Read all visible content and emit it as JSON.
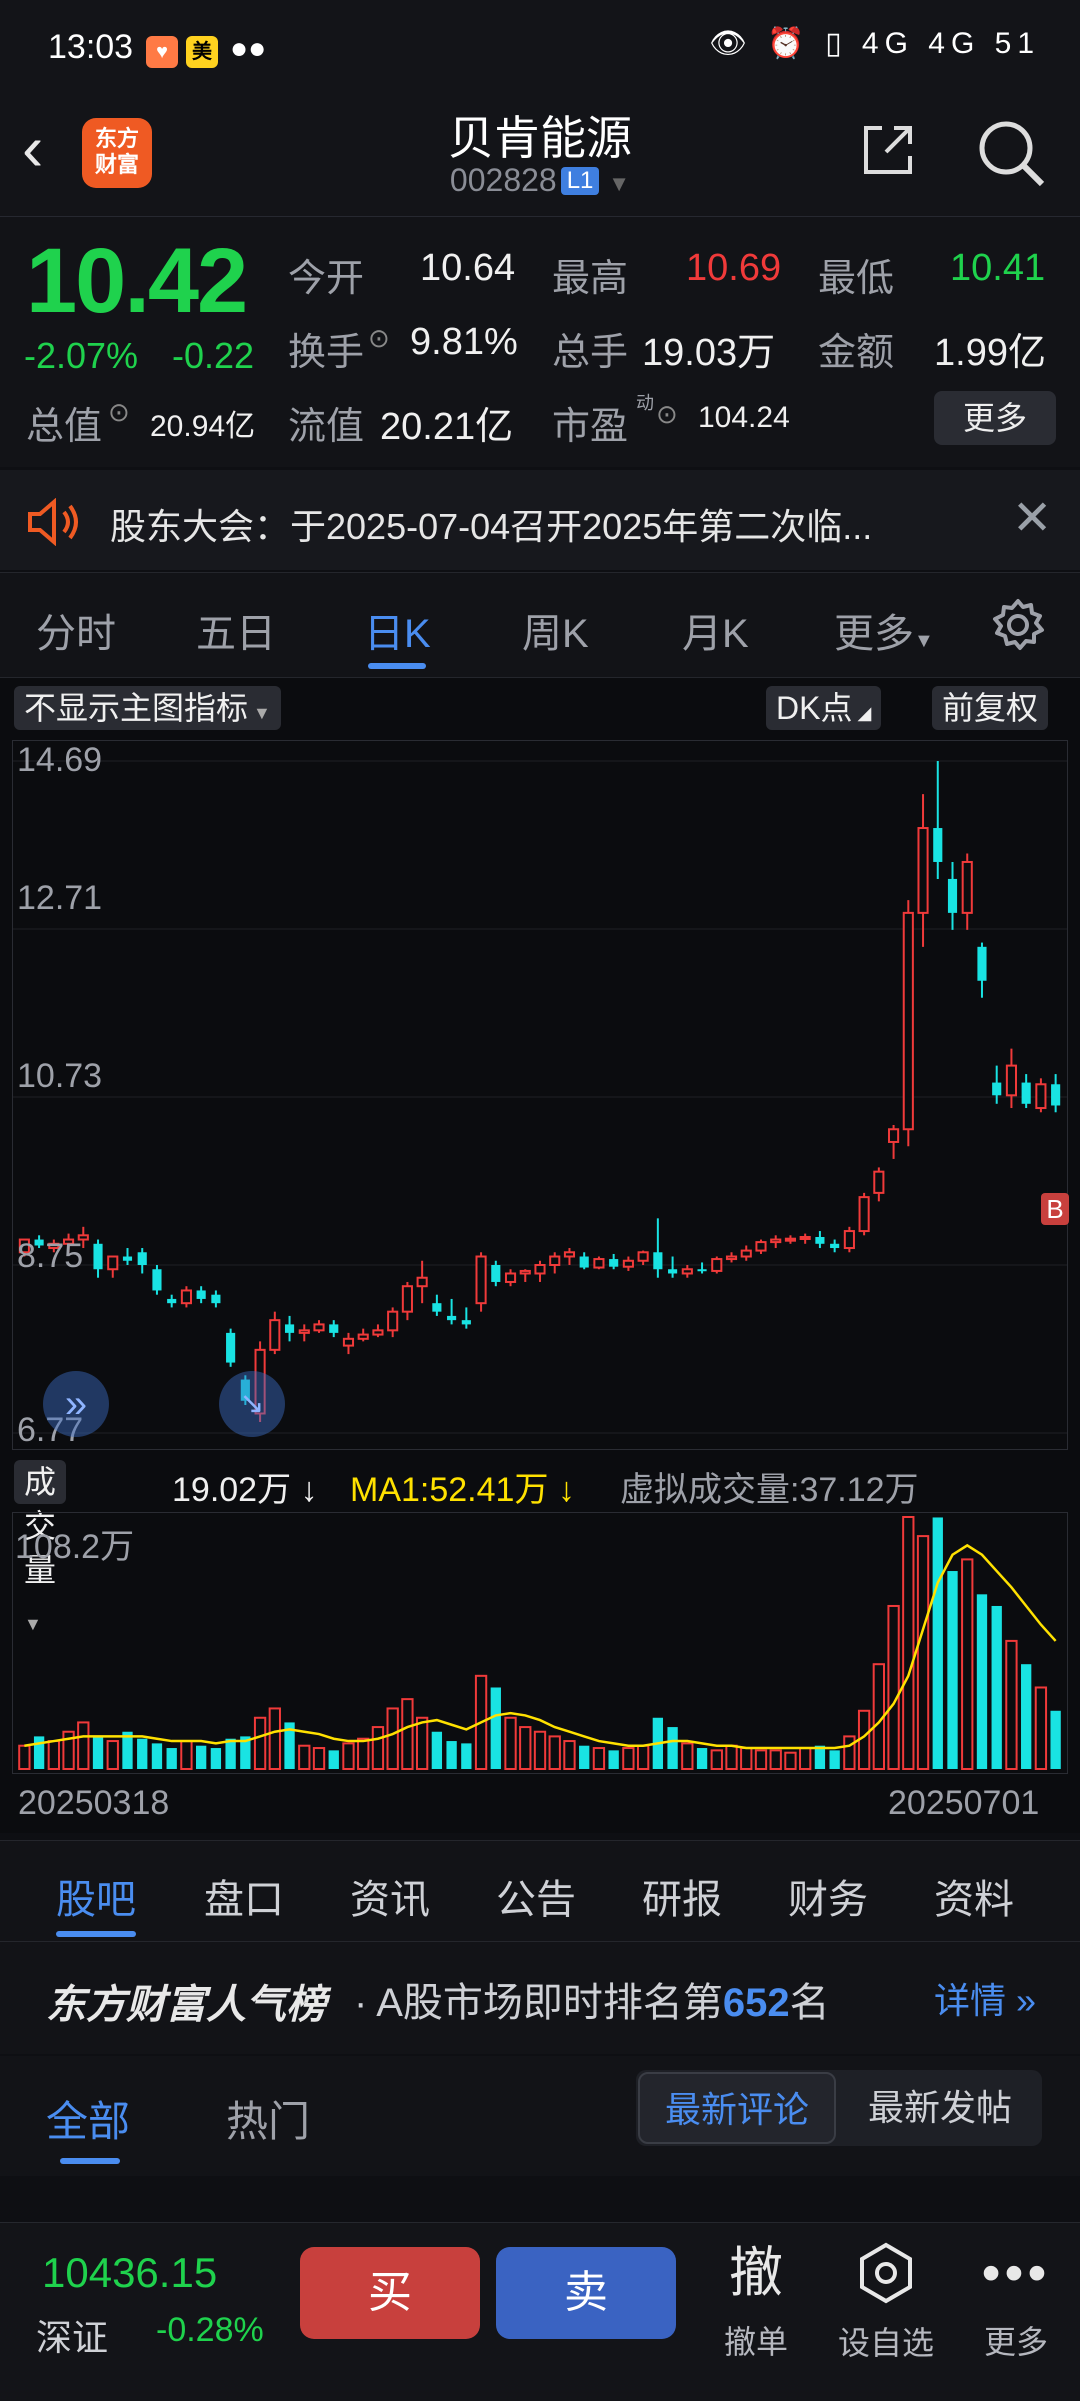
{
  "status": {
    "time": "13:03",
    "badge1": "♥",
    "badge2": "美",
    "right": "👁 ⏰ ▯ 4G 4G 51"
  },
  "header": {
    "back": "‹",
    "logo_line1": "东方",
    "logo_line2": "财富",
    "name": "贝肯能源",
    "code": "002828",
    "level": "L1"
  },
  "quote": {
    "price": "10.42",
    "pct": "-2.07%",
    "chg": "-0.22",
    "open_label": "今开",
    "open": "10.64",
    "high_label": "最高",
    "high": "10.69",
    "low_label": "最低",
    "low": "10.41",
    "turnover_label": "换手",
    "turnover": "9.81%",
    "volume_label": "总手",
    "volume": "19.03万",
    "amount_label": "金额",
    "amount": "1.99亿",
    "mcap_label": "总值",
    "mcap": "20.94亿",
    "float_label": "流值",
    "float": "20.21亿",
    "pe_label": "市盈",
    "pe_sup": "动",
    "pe": "104.24",
    "more": "更多"
  },
  "notice": {
    "text": "股东大会：于2025-07-04召开2025年第二次临..."
  },
  "ktabs": [
    "分时",
    "五日",
    "日K",
    "周K",
    "月K",
    "更多"
  ],
  "chart_controls": {
    "indicator": "不显示主图指标",
    "dk": "DK点",
    "adjust": "前复权"
  },
  "volume_head": {
    "label": "成交量",
    "current": "19.02万",
    "ma1": "MA1:52.41万",
    "virtual": "虚拟成交量:37.12万"
  },
  "colors": {
    "up": "#f03a3a",
    "down": "#1fd24d",
    "candle_down": "#19e3e3",
    "ma": "#ffe100",
    "accent": "#4a8df0"
  },
  "chart_data": {
    "type": "candlestick",
    "y_ticks": [
      "14.69",
      "12.71",
      "10.73",
      "8.75",
      "6.77"
    ],
    "ylim": [
      6.77,
      14.69
    ],
    "x_start": "20250318",
    "x_end": "20250701",
    "marker": "B",
    "candles": [
      [
        8.9,
        9.05,
        8.85,
        9.05
      ],
      [
        9.05,
        9.1,
        8.95,
        8.98
      ],
      [
        8.95,
        9.05,
        8.9,
        9.0
      ],
      [
        9.0,
        9.12,
        8.9,
        9.05
      ],
      [
        9.05,
        9.2,
        8.95,
        9.1
      ],
      [
        9.0,
        9.05,
        8.6,
        8.7
      ],
      [
        8.7,
        8.85,
        8.6,
        8.85
      ],
      [
        8.85,
        8.95,
        8.75,
        8.8
      ],
      [
        8.9,
        8.95,
        8.65,
        8.75
      ],
      [
        8.7,
        8.75,
        8.4,
        8.45
      ],
      [
        8.35,
        8.4,
        8.25,
        8.3
      ],
      [
        8.3,
        8.5,
        8.25,
        8.45
      ],
      [
        8.45,
        8.5,
        8.3,
        8.35
      ],
      [
        8.4,
        8.45,
        8.25,
        8.3
      ],
      [
        7.95,
        8.0,
        7.55,
        7.6
      ],
      [
        7.4,
        7.45,
        7.1,
        7.15
      ],
      [
        7.0,
        7.85,
        6.9,
        7.75
      ],
      [
        7.75,
        8.2,
        7.7,
        8.1
      ],
      [
        8.05,
        8.15,
        7.85,
        7.95
      ],
      [
        7.95,
        8.05,
        7.85,
        7.98
      ],
      [
        7.98,
        8.1,
        7.95,
        8.05
      ],
      [
        8.05,
        8.1,
        7.9,
        7.95
      ],
      [
        7.8,
        7.95,
        7.7,
        7.88
      ],
      [
        7.88,
        8.0,
        7.85,
        7.93
      ],
      [
        7.93,
        8.05,
        7.9,
        7.98
      ],
      [
        7.98,
        8.25,
        7.9,
        8.2
      ],
      [
        8.2,
        8.55,
        8.1,
        8.5
      ],
      [
        8.5,
        8.8,
        8.3,
        8.6
      ],
      [
        8.3,
        8.4,
        8.15,
        8.2
      ],
      [
        8.15,
        8.35,
        8.05,
        8.1
      ],
      [
        8.1,
        8.25,
        8.0,
        8.05
      ],
      [
        8.3,
        8.9,
        8.2,
        8.85
      ],
      [
        8.75,
        8.8,
        8.5,
        8.55
      ],
      [
        8.55,
        8.7,
        8.5,
        8.65
      ],
      [
        8.65,
        8.7,
        8.55,
        8.68
      ],
      [
        8.65,
        8.8,
        8.55,
        8.75
      ],
      [
        8.75,
        8.9,
        8.65,
        8.85
      ],
      [
        8.85,
        8.95,
        8.75,
        8.9
      ],
      [
        8.85,
        8.9,
        8.7,
        8.72
      ],
      [
        8.72,
        8.85,
        8.7,
        8.82
      ],
      [
        8.82,
        8.88,
        8.7,
        8.73
      ],
      [
        8.73,
        8.85,
        8.68,
        8.8
      ],
      [
        8.8,
        8.92,
        8.75,
        8.9
      ],
      [
        8.9,
        9.3,
        8.6,
        8.7
      ],
      [
        8.7,
        8.85,
        8.6,
        8.65
      ],
      [
        8.65,
        8.75,
        8.6,
        8.7
      ],
      [
        8.7,
        8.78,
        8.65,
        8.68
      ],
      [
        8.68,
        8.85,
        8.65,
        8.82
      ],
      [
        8.82,
        8.9,
        8.78,
        8.85
      ],
      [
        8.85,
        8.98,
        8.8,
        8.92
      ],
      [
        8.92,
        9.05,
        8.88,
        9.02
      ],
      [
        9.02,
        9.1,
        8.95,
        9.05
      ],
      [
        9.05,
        9.1,
        9.0,
        9.06
      ],
      [
        9.06,
        9.12,
        9.0,
        9.08
      ],
      [
        9.08,
        9.15,
        8.95,
        9.0
      ],
      [
        9.0,
        9.05,
        8.9,
        8.95
      ],
      [
        8.95,
        9.2,
        8.9,
        9.15
      ],
      [
        9.15,
        9.6,
        9.1,
        9.55
      ],
      [
        9.6,
        9.9,
        9.5,
        9.85
      ],
      [
        10.2,
        10.4,
        10.0,
        10.35
      ],
      [
        10.35,
        13.05,
        10.15,
        12.9
      ],
      [
        12.9,
        14.3,
        12.5,
        13.9
      ],
      [
        13.9,
        14.69,
        13.3,
        13.5
      ],
      [
        13.3,
        13.5,
        12.7,
        12.9
      ],
      [
        12.9,
        13.6,
        12.7,
        13.5
      ],
      [
        12.5,
        12.55,
        11.9,
        12.1
      ],
      [
        10.9,
        11.1,
        10.65,
        10.75
      ],
      [
        10.75,
        11.3,
        10.6,
        11.1
      ],
      [
        10.9,
        11.0,
        10.6,
        10.65
      ],
      [
        10.6,
        10.95,
        10.55,
        10.88
      ],
      [
        10.88,
        11.0,
        10.55,
        10.63
      ]
    ],
    "volume_ylabel": "108.2万",
    "volume": [
      10,
      14,
      12,
      16,
      20,
      14,
      12,
      16,
      13,
      11,
      9,
      12,
      10,
      9,
      13,
      14,
      22,
      26,
      20,
      10,
      9,
      8,
      11,
      13,
      18,
      26,
      30,
      22,
      16,
      12,
      11,
      40,
      35,
      22,
      18,
      16,
      14,
      12,
      10,
      9,
      8,
      9,
      10,
      22,
      18,
      11,
      9,
      8,
      10,
      9,
      8,
      8,
      7,
      9,
      10,
      8,
      14,
      25,
      45,
      70,
      108.2,
      100,
      108,
      85,
      90,
      75,
      70,
      55,
      45,
      35,
      25
    ],
    "volume_ma": [
      10,
      11,
      12,
      13,
      14,
      14,
      14,
      14,
      14,
      13,
      12,
      12,
      12,
      11,
      12,
      12,
      14,
      16,
      17,
      16,
      15,
      13,
      12,
      12,
      13,
      15,
      18,
      20,
      21,
      19,
      17,
      20,
      23,
      24,
      23,
      21,
      18,
      16,
      14,
      12,
      11,
      10,
      10,
      11,
      12,
      12,
      11,
      10,
      10,
      9,
      9,
      9,
      9,
      9,
      9,
      9,
      10,
      14,
      20,
      28,
      40,
      60,
      80,
      92,
      96,
      92,
      85,
      78,
      70,
      62,
      55
    ]
  },
  "bottom_tabs": [
    "股吧",
    "盘口",
    "资讯",
    "公告",
    "研报",
    "财务",
    "资料"
  ],
  "rank": {
    "title": "东方财富人气榜",
    "prefix": "· A股市场即时排名第",
    "num": "652",
    "suffix": "名",
    "detail": "详情 »"
  },
  "filter": {
    "all": "全部",
    "hot": "热门",
    "latest_comments": "最新评论",
    "latest_posts": "最新发帖"
  },
  "trade": {
    "index_value": "10436.15",
    "index_name": "深证",
    "index_chg": "-0.28%",
    "buy": "买",
    "sell": "卖",
    "cancel_big": "撤",
    "cancel": "撤单",
    "watch": "设自选",
    "more": "更多"
  }
}
